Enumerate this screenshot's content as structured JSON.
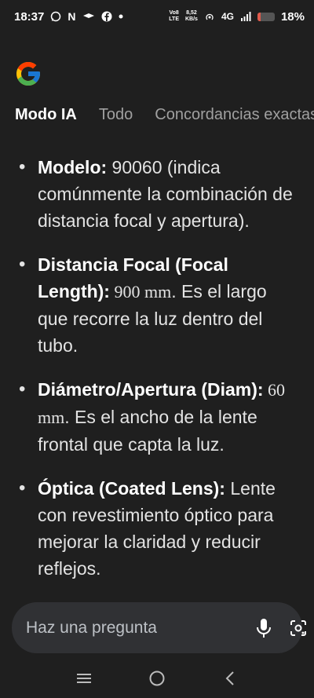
{
  "status_bar": {
    "time": "18:37",
    "notif_n": "N",
    "net_top": "Vo8",
    "net_bottom": "LTE",
    "speed_top": "8,52",
    "speed_bottom": "KB/s",
    "network": "4G",
    "battery_pct": "18%",
    "battery_level": 0.18,
    "battery_color": "#e05b4c"
  },
  "tabs": [
    {
      "label": "Modo IA",
      "active": true
    },
    {
      "label": "Todo",
      "active": false
    },
    {
      "label": "Concordancias exactas",
      "active": false
    }
  ],
  "items": [
    {
      "term": "Modelo:",
      "value": "",
      "text": " 90060 (indica comúnmente la combinación de distancia focal y apertura)."
    },
    {
      "term": "Distancia Focal (Focal Length):",
      "value": " 900 mm",
      "text": ". Es el largo que recorre la luz dentro del tubo."
    },
    {
      "term": "Diámetro/Apertura (Diam):",
      "value": " 60 mm",
      "text": ". Es el ancho de la lente frontal que capta la luz."
    },
    {
      "term": "Óptica (Coated Lens):",
      "value": "",
      "text": " Lente con revestimiento óptico para mejorar la claridad y reducir reflejos."
    }
  ],
  "ask": {
    "placeholder": "Haz una pregunta"
  },
  "icons": {
    "logo": "google-logo",
    "mic": "mic-icon",
    "lens": "google-lens-icon",
    "nav_recents": "recents-icon",
    "nav_home": "home-icon",
    "nav_back": "back-icon"
  }
}
